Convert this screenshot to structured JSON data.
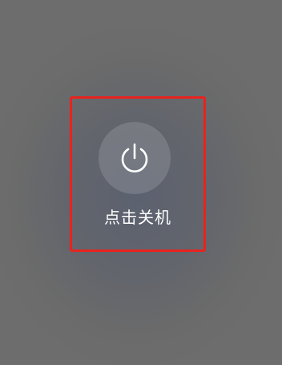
{
  "power_menu": {
    "icon": "power-icon",
    "label": "点击关机",
    "highlight_color": "#e8231f"
  }
}
